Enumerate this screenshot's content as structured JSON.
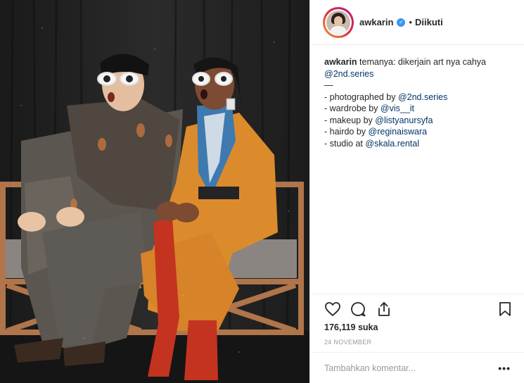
{
  "post": {
    "username": "awkarin",
    "separator": "•",
    "follow_status": "Diikuti",
    "caption_lines": [
      {
        "prefix": "awkarin",
        "text": " temanya: dikerjain art nya cahya"
      },
      {
        "link": "@2nd.series"
      },
      {
        "text": "—"
      },
      {
        "text": "- photographed by ",
        "link": "@2nd.series"
      },
      {
        "text": "- wardrobe by ",
        "link": "@vis__it"
      },
      {
        "text": "- makeup by ",
        "link": "@listyanursyfa"
      },
      {
        "text": "- hairdo by ",
        "link": "@reginaiswara"
      },
      {
        "text": "- studio at ",
        "link": "@skala.rental"
      }
    ],
    "likes": "176,119 suka",
    "date": "24 NOVEMBER",
    "comment_placeholder": "Tambahkan komentar...",
    "more_label": "•••"
  },
  "icons": {
    "like": "heart-icon",
    "comment": "comment-icon",
    "share": "share-icon",
    "save": "bookmark-icon",
    "verified": "verified-badge-icon"
  },
  "colors": {
    "link": "#003569",
    "verified": "#3897f0",
    "muted": "#999999",
    "text": "#262626"
  }
}
